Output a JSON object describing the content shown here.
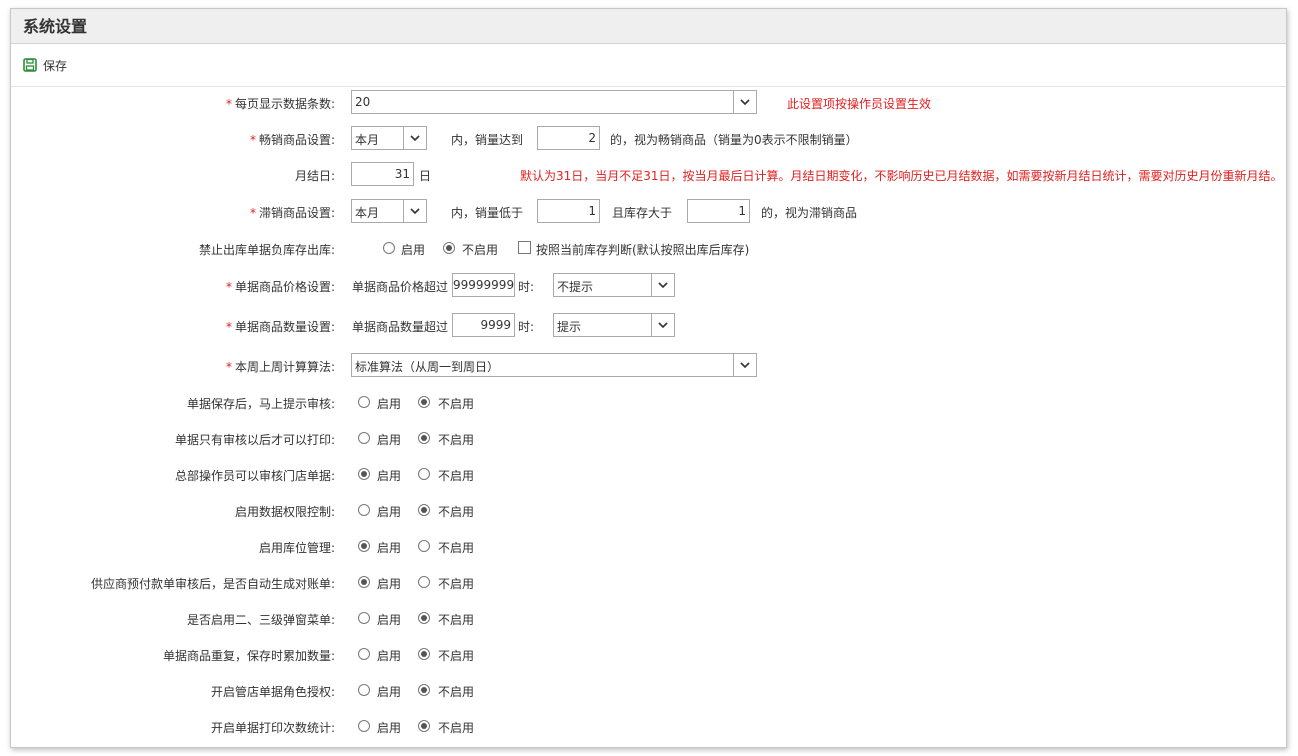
{
  "title": "系统设置",
  "toolbar": {
    "save_label": "保存"
  },
  "colors": {
    "required": "#e02020",
    "note": "#e02020",
    "save_icon": "#2e8b3d"
  },
  "rows": {
    "page_size": {
      "label": "每页显示数据条数:",
      "value": "20",
      "note": "此设置项按操作员设置生效"
    },
    "bestseller": {
      "label": "畅销商品设置:",
      "period": "本月",
      "text1": "内，销量达到",
      "qty": "2",
      "text2": "的，视为畅销商品（销量为0表示不限制销量）"
    },
    "month_end": {
      "label": "月结日:",
      "value": "31",
      "unit": "日",
      "note": "默认为31日，当月不足31日，按当月最后日计算。月结日期变化，不影响历史已月结数据，如需要按新月结日统计，需要对历史月份重新月结。"
    },
    "slow": {
      "label": "滞销商品设置:",
      "period": "本月",
      "text1": "内，销量低于",
      "qty": "1",
      "text2": "且库存大于",
      "stock": "1",
      "text3": "的，视为滞销商品"
    },
    "negative_stock": {
      "label": "禁止出库单据负库存出库:",
      "opt_on": "启用",
      "opt_off": "不启用",
      "check_label": "按照当前库存判断(默认按照出库后库存)"
    },
    "price": {
      "label": "单据商品价格设置:",
      "text1": "单据商品价格超过",
      "value": "99999999",
      "text2": "时:",
      "action": "不提示"
    },
    "qty": {
      "label": "单据商品数量设置:",
      "text1": "单据商品数量超过",
      "value": "9999",
      "text2": "时:",
      "action": "提示"
    },
    "week_calc": {
      "label": "本周上周计算算法:",
      "value": "标准算法（从周一到周日）"
    }
  },
  "toggles": [
    {
      "label": "单据保存后，马上提示审核:",
      "on": "启用",
      "off": "不启用",
      "enabled": false
    },
    {
      "label": "单据只有审核以后才可以打印:",
      "on": "启用",
      "off": "不启用",
      "enabled": false
    },
    {
      "label": "总部操作员可以审核门店单据:",
      "on": "启用",
      "off": "不启用",
      "enabled": true
    },
    {
      "label": "启用数据权限控制:",
      "on": "启用",
      "off": "不启用",
      "enabled": false
    },
    {
      "label": "启用库位管理:",
      "on": "启用",
      "off": "不启用",
      "enabled": true
    },
    {
      "label": "供应商预付款单审核后，是否自动生成对账单:",
      "on": "启用",
      "off": "不启用",
      "enabled": true
    },
    {
      "label": "是否启用二、三级弹窗菜单:",
      "on": "启用",
      "off": "不启用",
      "enabled": false
    },
    {
      "label": "单据商品重复，保存时累加数量:",
      "on": "启用",
      "off": "不启用",
      "enabled": false
    },
    {
      "label": "开启管店单据角色授权:",
      "on": "启用",
      "off": "不启用",
      "enabled": false
    },
    {
      "label": "开启单据打印次数统计:",
      "on": "启用",
      "off": "不启用",
      "enabled": false
    }
  ]
}
